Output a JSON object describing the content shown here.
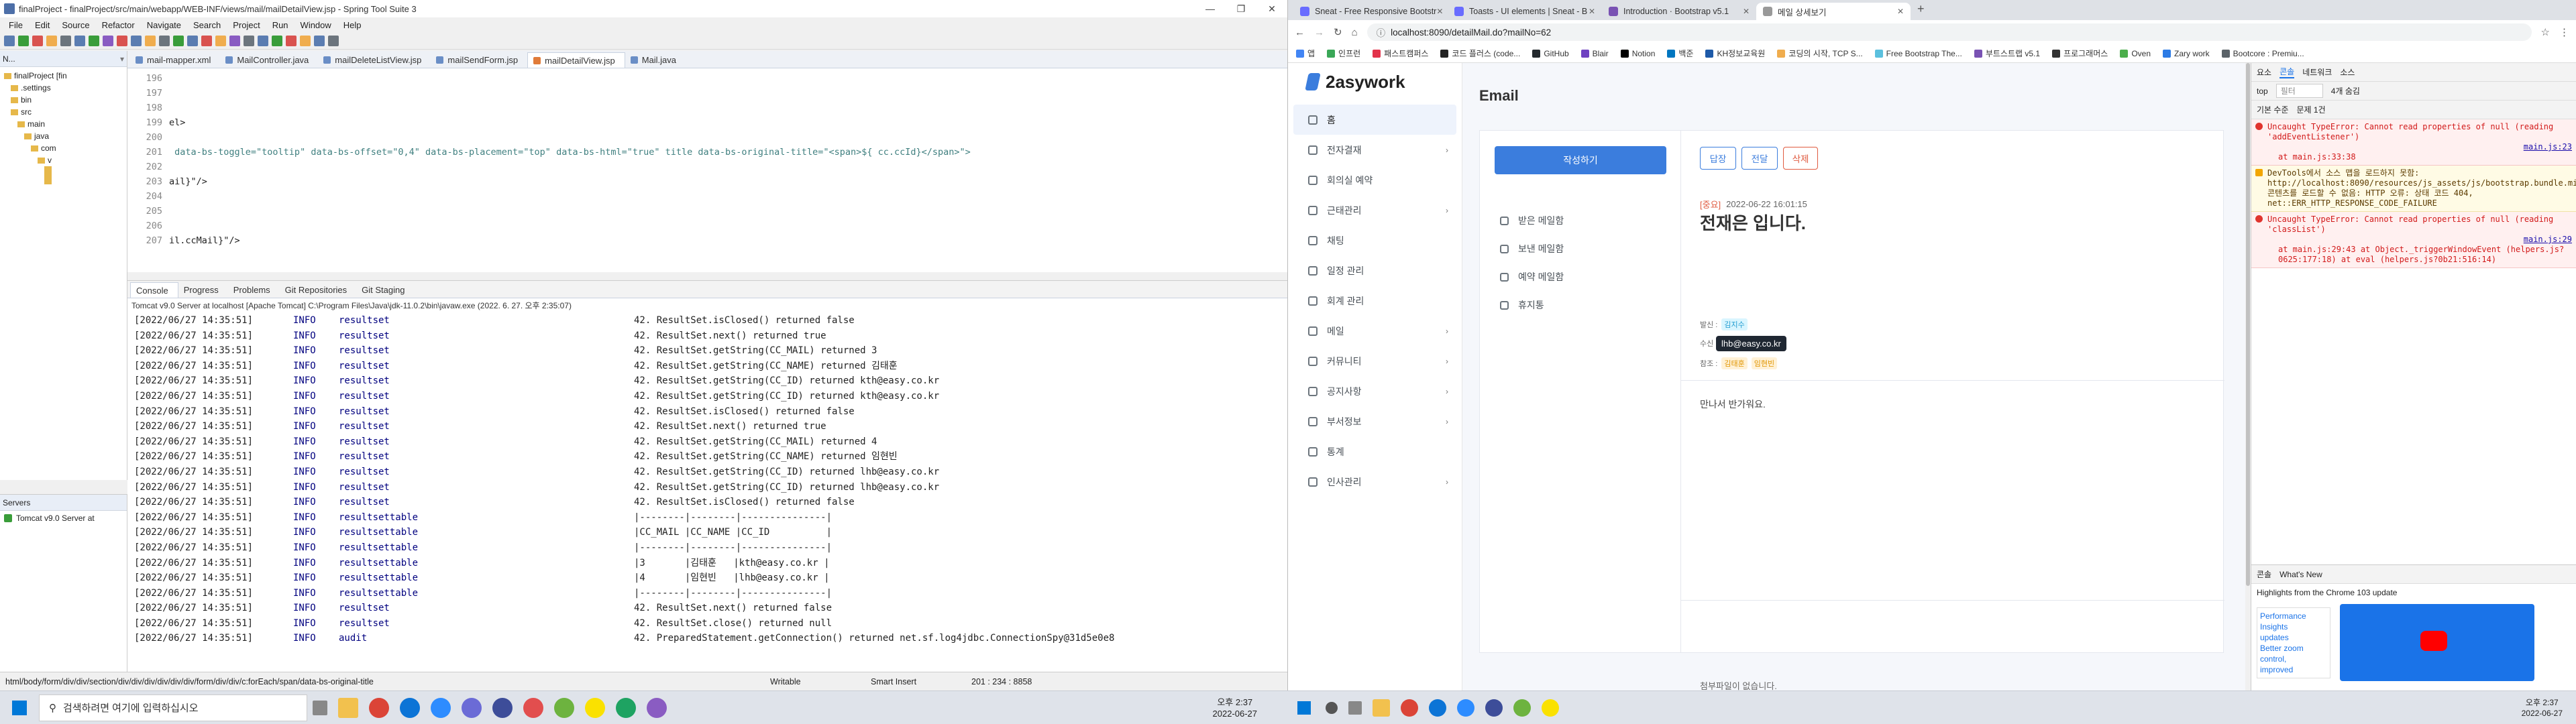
{
  "eclipse": {
    "title": "finalProject - finalProject/src/main/webapp/WEB-INF/views/mail/mailDetailView.jsp - Spring Tool Suite 3",
    "menu": [
      "File",
      "Edit",
      "Source",
      "Refactor",
      "Navigate",
      "Search",
      "Project",
      "Run",
      "Window",
      "Help"
    ],
    "explorer_title": "N...",
    "tree": [
      {
        "label": "finalProject [fin",
        "indent": 0
      },
      {
        "label": ".settings",
        "indent": 1
      },
      {
        "label": "bin",
        "indent": 1
      },
      {
        "label": "src",
        "indent": 1
      },
      {
        "label": "main",
        "indent": 2
      },
      {
        "label": "java",
        "indent": 3
      },
      {
        "label": "com",
        "indent": 4
      },
      {
        "label": "v",
        "indent": 5
      },
      {
        "label": "",
        "indent": 6
      },
      {
        "label": "",
        "indent": 6
      },
      {
        "label": "",
        "indent": 6
      }
    ],
    "servers_title": "Servers",
    "server_item": "Tomcat v9.0 Server at",
    "editor_tabs": [
      {
        "label": "mail-mapper.xml",
        "active": false
      },
      {
        "label": "MailController.java",
        "active": false
      },
      {
        "label": "mailDeleteListView.jsp",
        "active": false
      },
      {
        "label": "mailSendForm.jsp",
        "active": false
      },
      {
        "label": "mailDetailView.jsp",
        "active": true
      },
      {
        "label": "Mail.java",
        "active": false
      }
    ],
    "code_lines": [
      {
        "num": "196",
        "text": ""
      },
      {
        "num": "197",
        "text": ""
      },
      {
        "num": "198",
        "text": ""
      },
      {
        "num": "199",
        "text": "el>"
      },
      {
        "num": "200",
        "text": ""
      },
      {
        "num": "201",
        "text": " data-bs-toggle=\"tooltip\" data-bs-offset=\"0,4\" data-bs-placement=\"top\" data-bs-html=\"true\" title data-bs-original-title=\"<span>${ cc.ccId}</span>\">"
      },
      {
        "num": "202",
        "text": ""
      },
      {
        "num": "203",
        "text": "ail}\"/>"
      },
      {
        "num": "204",
        "text": ""
      },
      {
        "num": "205",
        "text": ""
      },
      {
        "num": "206",
        "text": ""
      },
      {
        "num": "207",
        "text": "il.ccMail}\"/>"
      }
    ],
    "console_tabs": [
      "Console",
      "Progress",
      "Problems",
      "Git Repositories",
      "Git Staging"
    ],
    "console_header": "Tomcat v9.0 Server at localhost [Apache Tomcat] C:\\Program Files\\Java\\jdk-11.0.2\\bin\\javaw.exe  (2022. 6. 27. 오후 2:35:07)",
    "console_lines": [
      {
        "time": "[2022/06/27 14:35:51]",
        "level": "INFO",
        "logger": "resultset",
        "msg": "42. ResultSet.isClosed() returned false"
      },
      {
        "time": "[2022/06/27 14:35:51]",
        "level": "INFO",
        "logger": "resultset",
        "msg": "42. ResultSet.next() returned true"
      },
      {
        "time": "[2022/06/27 14:35:51]",
        "level": "INFO",
        "logger": "resultset",
        "msg": "42. ResultSet.getString(CC_MAIL) returned 3"
      },
      {
        "time": "[2022/06/27 14:35:51]",
        "level": "INFO",
        "logger": "resultset",
        "msg": "42. ResultSet.getString(CC_NAME) returned 김태훈"
      },
      {
        "time": "[2022/06/27 14:35:51]",
        "level": "INFO",
        "logger": "resultset",
        "msg": "42. ResultSet.getString(CC_ID) returned kth@easy.co.kr"
      },
      {
        "time": "[2022/06/27 14:35:51]",
        "level": "INFO",
        "logger": "resultset",
        "msg": "42. ResultSet.getString(CC_ID) returned kth@easy.co.kr"
      },
      {
        "time": "[2022/06/27 14:35:51]",
        "level": "INFO",
        "logger": "resultset",
        "msg": "42. ResultSet.isClosed() returned false"
      },
      {
        "time": "[2022/06/27 14:35:51]",
        "level": "INFO",
        "logger": "resultset",
        "msg": "42. ResultSet.next() returned true"
      },
      {
        "time": "[2022/06/27 14:35:51]",
        "level": "INFO",
        "logger": "resultset",
        "msg": "42. ResultSet.getString(CC_MAIL) returned 4"
      },
      {
        "time": "[2022/06/27 14:35:51]",
        "level": "INFO",
        "logger": "resultset",
        "msg": "42. ResultSet.getString(CC_NAME) returned 임현빈"
      },
      {
        "time": "[2022/06/27 14:35:51]",
        "level": "INFO",
        "logger": "resultset",
        "msg": "42. ResultSet.getString(CC_ID) returned lhb@easy.co.kr"
      },
      {
        "time": "[2022/06/27 14:35:51]",
        "level": "INFO",
        "logger": "resultset",
        "msg": "42. ResultSet.getString(CC_ID) returned lhb@easy.co.kr"
      },
      {
        "time": "[2022/06/27 14:35:51]",
        "level": "INFO",
        "logger": "resultset",
        "msg": "42. ResultSet.isClosed() returned false"
      },
      {
        "time": "[2022/06/27 14:35:51]",
        "level": "INFO",
        "logger": "resultsettable",
        "msg": "|--------|--------|---------------|"
      },
      {
        "time": "[2022/06/27 14:35:51]",
        "level": "INFO",
        "logger": "resultsettable",
        "msg": "|CC_MAIL |CC_NAME |CC_ID          |"
      },
      {
        "time": "[2022/06/27 14:35:51]",
        "level": "INFO",
        "logger": "resultsettable",
        "msg": "|--------|--------|---------------|"
      },
      {
        "time": "[2022/06/27 14:35:51]",
        "level": "INFO",
        "logger": "resultsettable",
        "msg": "|3       |김태훈   |kth@easy.co.kr |"
      },
      {
        "time": "[2022/06/27 14:35:51]",
        "level": "INFO",
        "logger": "resultsettable",
        "msg": "|4       |임현빈   |lhb@easy.co.kr |"
      },
      {
        "time": "[2022/06/27 14:35:51]",
        "level": "INFO",
        "logger": "resultsettable",
        "msg": "|--------|--------|---------------|"
      },
      {
        "time": "[2022/06/27 14:35:51]",
        "level": "INFO",
        "logger": "resultset",
        "msg": "42. ResultSet.next() returned false"
      },
      {
        "time": "[2022/06/27 14:35:51]",
        "level": "INFO",
        "logger": "resultset",
        "msg": "42. ResultSet.close() returned null"
      },
      {
        "time": "[2022/06/27 14:35:51]",
        "level": "INFO",
        "logger": "audit",
        "msg": "42. PreparedStatement.getConnection() returned net.sf.log4jdbc.ConnectionSpy@31d5e0e8"
      }
    ],
    "status": {
      "path": "html/body/form/div/div/section/div/div/div/div/div/div/form/div/div/c:forEach/span/data-bs-original-title",
      "mode": "Writable",
      "insert": "Smart Insert",
      "pos": "201 : 234 : 8858"
    }
  },
  "taskbar_left": {
    "search_placeholder": "검색하려면 여기에 입력하십시오",
    "time": "오후 2:37",
    "date": "2022-06-27"
  },
  "taskbar_right": {
    "time": "오후 2:37",
    "date": "2022-06-27"
  },
  "chrome": {
    "tabs": [
      {
        "label": "Sneat - Free Responsive Bootstr",
        "color": "#696cff",
        "active": false
      },
      {
        "label": "Toasts - UI elements | Sneat - B",
        "color": "#696cff",
        "active": false
      },
      {
        "label": "Introduction · Bootstrap v5.1",
        "color": "#7952b3",
        "active": false
      },
      {
        "label": "메일 상세보기",
        "color": "#999999",
        "active": true
      }
    ],
    "url": "localhost:8090/detailMail.do?mailNo=62",
    "bookmarks": [
      "앱",
      "인프런",
      "패스트캠퍼스",
      "코드 플러스 (code...",
      "GitHub",
      "Blair",
      "Notion",
      "백준",
      "KH정보교육원",
      "코딩의 시작, TCP S...",
      "Free Bootstrap The...",
      "부트스트랩 v5.1",
      "프로그래머스",
      "Oven",
      "Zary work",
      "Bootcore : Premiu..."
    ],
    "bookmark_colors": [
      "#4285f4",
      "#3aa757",
      "#e2334b",
      "#222222",
      "#24292e",
      "#6f42c1",
      "#000000",
      "#0076c0",
      "#1e5aa8",
      "#f0ad4e",
      "#5bc0de",
      "#7952b3",
      "#333333",
      "#4cae4c",
      "#2c7be5",
      "#5a6268"
    ]
  },
  "app": {
    "brand": "2asywork",
    "page_title": "Email",
    "nav": [
      {
        "label": "홈",
        "active": true,
        "chevron": false
      },
      {
        "label": "전자결재",
        "active": false,
        "chevron": true
      },
      {
        "label": "회의실 예약",
        "active": false,
        "chevron": false
      },
      {
        "label": "근태관리",
        "active": false,
        "chevron": true
      },
      {
        "label": "채팅",
        "active": false,
        "chevron": false
      },
      {
        "label": "일정 관리",
        "active": false,
        "chevron": false
      },
      {
        "label": "회계 관리",
        "active": false,
        "chevron": false
      },
      {
        "label": "메일",
        "active": false,
        "chevron": true
      },
      {
        "label": "커뮤니티",
        "active": false,
        "chevron": true
      },
      {
        "label": "공지사항",
        "active": false,
        "chevron": true
      },
      {
        "label": "부서정보",
        "active": false,
        "chevron": true
      },
      {
        "label": "통계",
        "active": false,
        "chevron": false
      },
      {
        "label": "인사관리",
        "active": false,
        "chevron": true
      }
    ],
    "compose_button": "작성하기",
    "folders": [
      "받은 메일함",
      "보낸 메일함",
      "예약 메일함",
      "휴지통"
    ],
    "actions": [
      "답장",
      "전달",
      "삭제"
    ],
    "mail": {
      "importance": "[중요]",
      "date": "2022-06-22 16:01:15",
      "subject": "전재은 입니다.",
      "from_label": "발신 :",
      "from": "김지수",
      "to_label": "수신 :",
      "cc_label": "참조 :",
      "cc": [
        "김태훈",
        "임현빈"
      ],
      "tooltip": "lhb@easy.co.kr",
      "body": "만나서 반가워요.",
      "attachment": "첨부파일이 없습니다."
    }
  },
  "devtools": {
    "tabs": [
      "요소",
      "콘솔",
      "네트워크",
      "소스"
    ],
    "context": "top",
    "filter_placeholder": "필터",
    "level": "기본 수준",
    "issues": "문제 1건",
    "hidden": "4개 숨김",
    "errors": [
      {
        "type": "error",
        "text": "Uncaught TypeError: Cannot read properties of null (reading 'addEventListener')",
        "src": "main.js:23",
        "sub": "at main.js:33:38"
      },
      {
        "type": "warn",
        "text": "DevTools에서 소스 맵을 로드하지 못함: http://localhost:8090/resources/js_assets/js/bootstrap.bundle.min.js.map 콘텐츠를 로드할 수 없음: HTTP 오류: 상태 코드 404, net::ERR_HTTP_RESPONSE_CODE_FAILURE",
        "src": "",
        "sub": ""
      },
      {
        "type": "error",
        "text": "Uncaught TypeError: Cannot read properties of null (reading 'classList')",
        "src": "main.js:29",
        "sub": "at main.js:29:43  at Object._triggerWindowEvent (helpers.js?0625:177:18)  at eval (helpers.js?0b21:516:14)"
      }
    ],
    "drawer_tabs": [
      "콘솔",
      "What's New"
    ],
    "whatsnew_heading": "Highlights from the Chrome 103 update",
    "whatsnew_items": [
      "Performance",
      "Insights",
      "updates",
      "Better zoom",
      "control,",
      "improved"
    ]
  }
}
